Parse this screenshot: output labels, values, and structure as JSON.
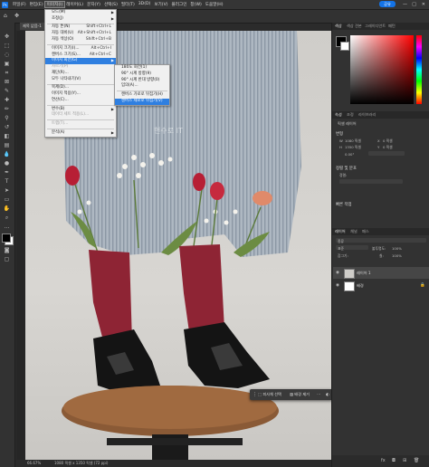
{
  "menubar": {
    "items": [
      "파일(F)",
      "편집(E)",
      "이미지(I)",
      "레이어(L)",
      "문자(Y)",
      "선택(S)",
      "필터(T)",
      "3D(D)",
      "보기(V)",
      "플러그인",
      "창(W)",
      "도움말(H)"
    ],
    "active_index": 2,
    "share_label": "공유",
    "window_controls": [
      "—",
      "□",
      "✕"
    ]
  },
  "document_tab": {
    "label": "제목 없음-1"
  },
  "image_menu": {
    "rows": [
      {
        "label": "모드(M)",
        "shortcut": "",
        "arrow": true,
        "disabled": false
      },
      {
        "label": "조정(J)",
        "shortcut": "",
        "arrow": true,
        "disabled": false
      },
      {
        "sep": true
      },
      {
        "label": "자동 톤(N)",
        "shortcut": "Shift+Ctrl+L",
        "arrow": false,
        "disabled": false
      },
      {
        "label": "자동 대비(U)",
        "shortcut": "Alt+Shift+Ctrl+L",
        "arrow": false,
        "disabled": false
      },
      {
        "label": "자동 색상(O)",
        "shortcut": "Shift+Ctrl+B",
        "arrow": false,
        "disabled": false
      },
      {
        "sep": true
      },
      {
        "label": "이미지 크기(I)...",
        "shortcut": "Alt+Ctrl+I",
        "arrow": false,
        "disabled": false
      },
      {
        "label": "캔버스 크기(S)...",
        "shortcut": "Alt+Ctrl+C",
        "arrow": false,
        "disabled": false
      },
      {
        "label": "이미지 회전(G)",
        "shortcut": "",
        "arrow": true,
        "disabled": false,
        "highlight": true
      },
      {
        "label": "자르기(P)",
        "shortcut": "",
        "arrow": false,
        "disabled": true
      },
      {
        "label": "재단(R)...",
        "shortcut": "",
        "arrow": false,
        "disabled": false
      },
      {
        "label": "모두 나타내기(V)",
        "shortcut": "",
        "arrow": false,
        "disabled": false
      },
      {
        "sep": true
      },
      {
        "label": "복제(D)...",
        "shortcut": "",
        "arrow": false,
        "disabled": false
      },
      {
        "label": "이미지 적용(Y)...",
        "shortcut": "",
        "arrow": false,
        "disabled": false
      },
      {
        "label": "연산(C)...",
        "shortcut": "",
        "arrow": false,
        "disabled": false
      },
      {
        "sep": true
      },
      {
        "label": "변수(B)",
        "shortcut": "",
        "arrow": true,
        "disabled": false
      },
      {
        "label": "데이터 세트 적용(L)...",
        "shortcut": "",
        "arrow": false,
        "disabled": true
      },
      {
        "sep": true
      },
      {
        "label": "트랩(T)...",
        "shortcut": "",
        "arrow": false,
        "disabled": true
      },
      {
        "sep": true
      },
      {
        "label": "분석(A)",
        "shortcut": "",
        "arrow": true,
        "disabled": false
      }
    ]
  },
  "rotate_submenu": {
    "rows": [
      {
        "label": "180도 회전(1)"
      },
      {
        "label": "90° 시계 방향(9)"
      },
      {
        "label": "90° 시계 반대 방향(0)"
      },
      {
        "label": "임의(A)..."
      },
      {
        "sep": true
      },
      {
        "label": "캔버스 가로로 뒤집기(H)"
      },
      {
        "label": "캔버스 세로로 뒤집기(V)",
        "highlight": true
      }
    ]
  },
  "canvas": {
    "watermark": "현수로 IT"
  },
  "statusbar": {
    "zoom": "66.67%",
    "info": "1080 픽셀 x 1350 픽셀 (72 ppi)"
  },
  "color_panel": {
    "tabs": [
      "색상",
      "색상 견본",
      "그레이디언트",
      "패턴"
    ]
  },
  "properties_panel": {
    "tabs": [
      "속성",
      "조정",
      "라이브러리"
    ],
    "doc_label": "픽셀 레이어",
    "transform_head": "변형",
    "w_label": "W",
    "w_value": "1080 픽셀",
    "h_label": "H",
    "h_value": "1350 픽셀",
    "x_label": "X",
    "x_value": "0 픽셀",
    "y_label": "Y",
    "y_value": "0 픽셀",
    "angle_value": "0.00°",
    "align_head": "정렬 및 분포",
    "align_sub": "정렬:",
    "quick_head": "빠른 작업"
  },
  "layers_panel": {
    "tabs": [
      "레이어",
      "채널",
      "패스"
    ],
    "kind_label": "종류",
    "blend_mode": "표준",
    "opacity_label": "불투명도:",
    "opacity_value": "100%",
    "lock_label": "잠그기:",
    "fill_label": "칠:",
    "fill_value": "100%",
    "layers": [
      {
        "name": "레이어 1",
        "selected": true
      },
      {
        "name": "배경",
        "selected": false
      }
    ]
  },
  "taskbar": {
    "select_subject": "피사체 선택",
    "remove_bg": "배경 제거"
  },
  "colors": {
    "accent": "#2f7fe0",
    "sock": "#8e2434",
    "shoe": "#141414",
    "stool": "#8a5a36"
  }
}
